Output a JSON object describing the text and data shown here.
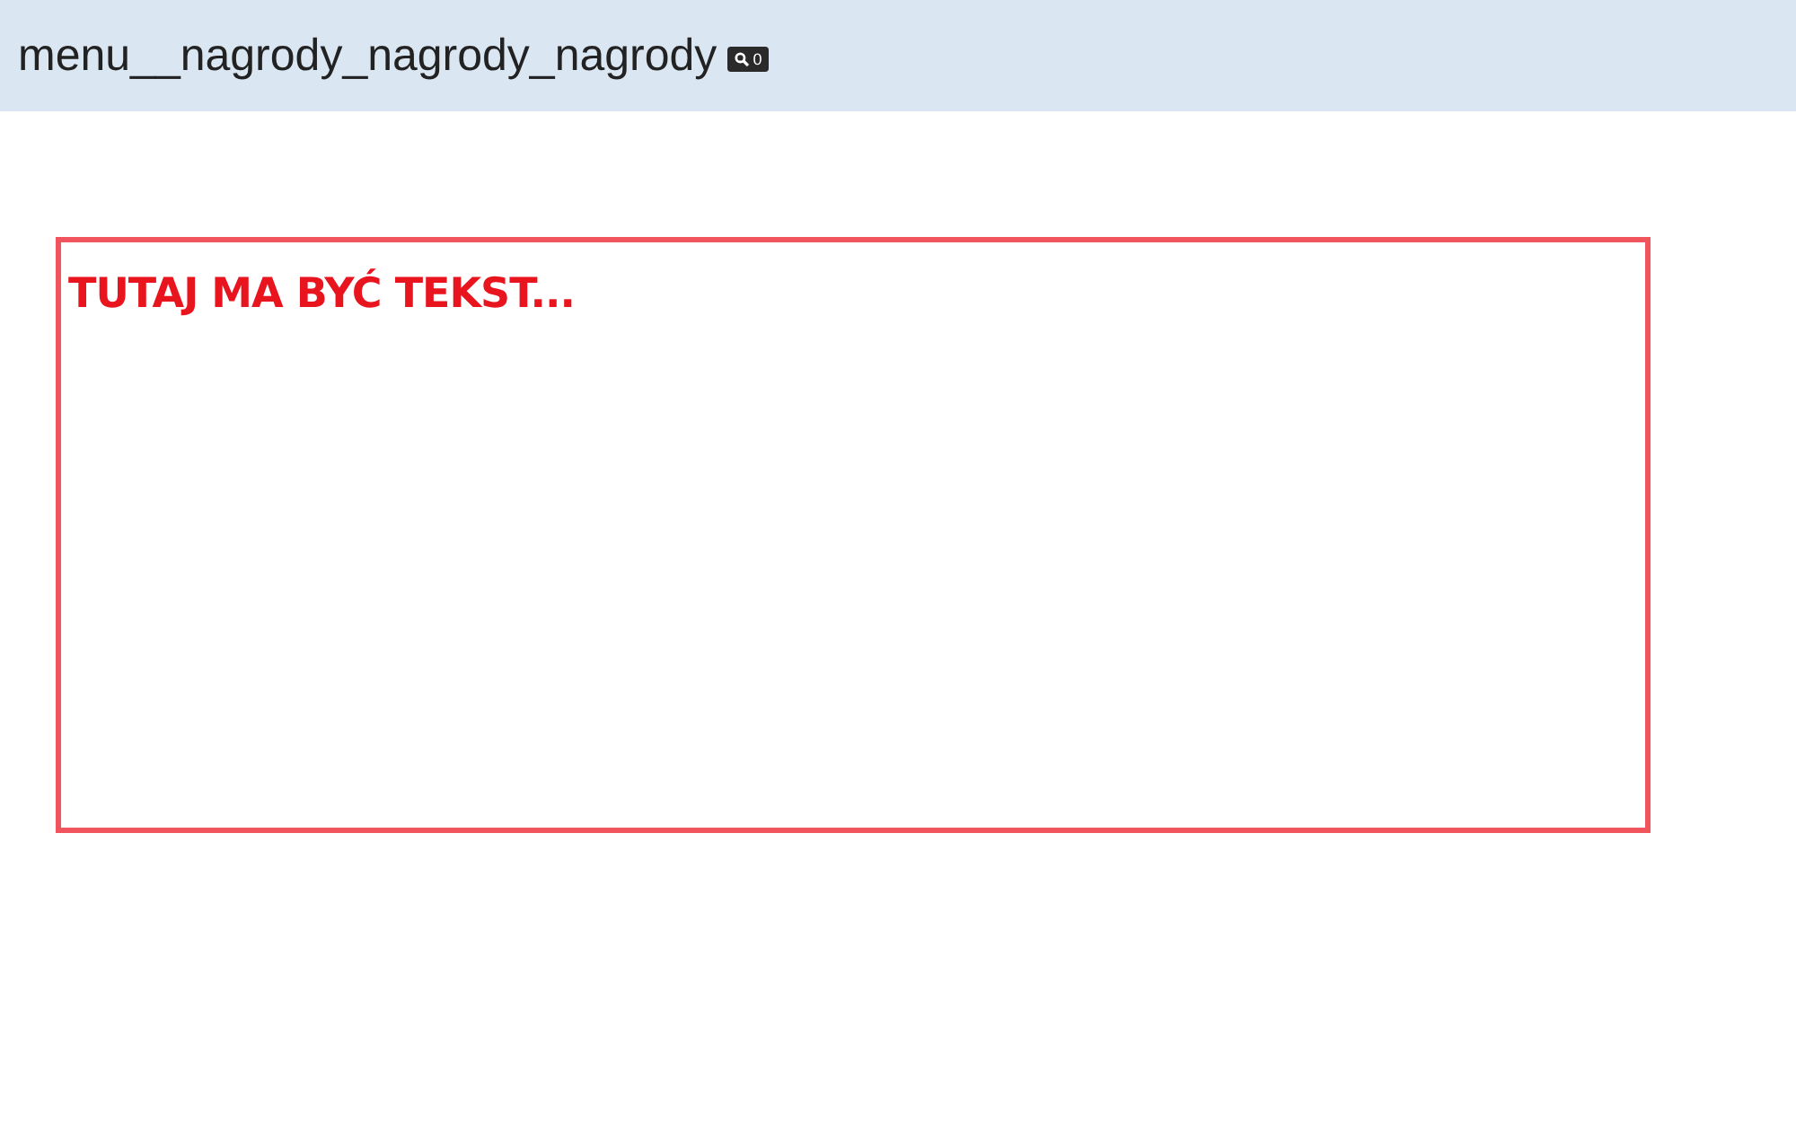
{
  "header": {
    "title": "menu__nagrody_nagrody_nagrody",
    "badge": {
      "count": "0"
    }
  },
  "panel": {
    "text": "TUTAJ MA BYĆ TEKST..."
  }
}
